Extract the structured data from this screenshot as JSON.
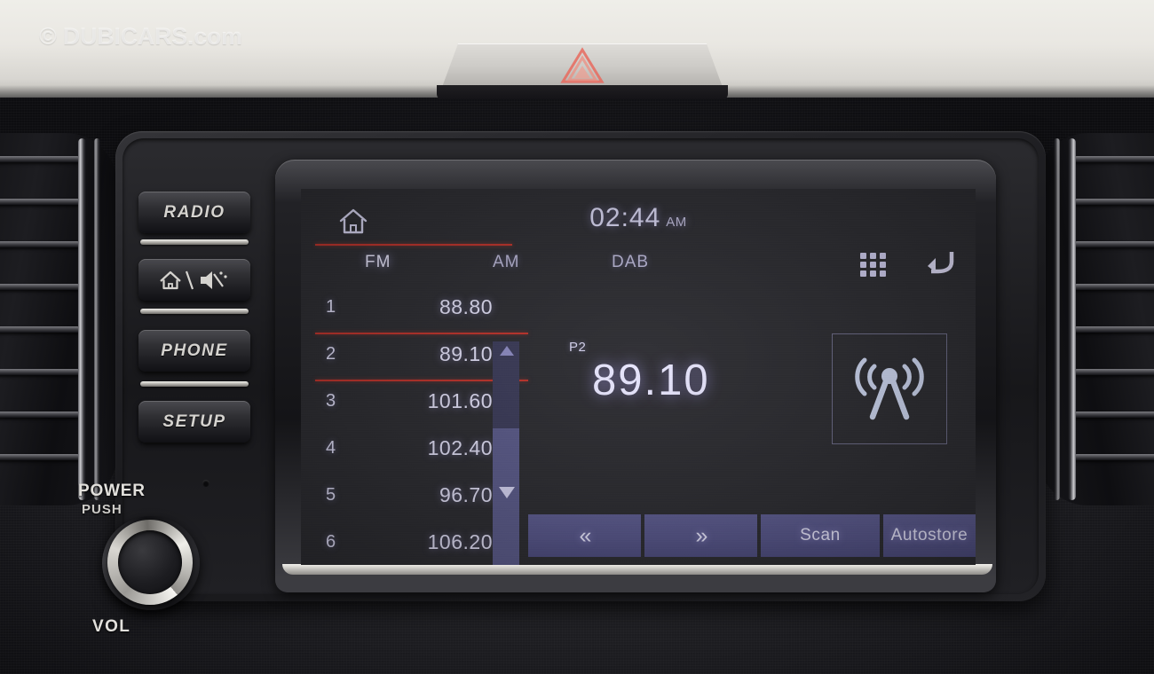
{
  "watermark": {
    "text": "© DUBICARS.com"
  },
  "dashboard": {
    "hazard_button": {
      "name": "hazard-warning-button",
      "symbol": "warning-triangle"
    },
    "side_buttons": [
      {
        "label": "RADIO",
        "name": "radio-button"
      },
      {
        "label": "",
        "name": "home-mute-button",
        "icon": "home-mute-icon"
      },
      {
        "label": "PHONE",
        "name": "phone-button"
      },
      {
        "label": "SETUP",
        "name": "setup-button"
      }
    ],
    "knob": {
      "power_label": "POWER",
      "push_label": "PUSH",
      "vol_label": "VOL"
    }
  },
  "screen": {
    "clock": {
      "time": "02:44",
      "ampm": "AM"
    },
    "home_icon": "home-icon",
    "grid_icon": "apps-grid-icon",
    "back_icon": "back-arrow-icon",
    "accent_red": "#c0322a",
    "accent_purple": "#56558a",
    "tabs": [
      {
        "label": "FM",
        "active": true
      },
      {
        "label": "AM",
        "active": false
      },
      {
        "label": "DAB",
        "active": false
      }
    ],
    "presets": [
      {
        "num": "1",
        "freq": "88.80",
        "selected": false
      },
      {
        "num": "2",
        "freq": "89.10",
        "selected": true
      },
      {
        "num": "3",
        "freq": "101.60",
        "selected": false
      },
      {
        "num": "4",
        "freq": "102.40",
        "selected": false
      },
      {
        "num": "5",
        "freq": "96.70",
        "selected": false
      },
      {
        "num": "6",
        "freq": "106.20",
        "selected": false
      }
    ],
    "now_playing": {
      "preset_label": "P2",
      "frequency": "89.10",
      "station_icon": "radio-antenna-icon"
    },
    "buttons": [
      {
        "label": "«",
        "name": "seek-down-button"
      },
      {
        "label": "»",
        "name": "seek-up-button"
      },
      {
        "label": "Scan",
        "name": "scan-button"
      },
      {
        "label": "Autostore",
        "name": "autostore-button"
      }
    ],
    "scrollbar": {
      "up_arrow": "scroll-up-arrow",
      "down_arrow": "scroll-down-arrow"
    }
  }
}
